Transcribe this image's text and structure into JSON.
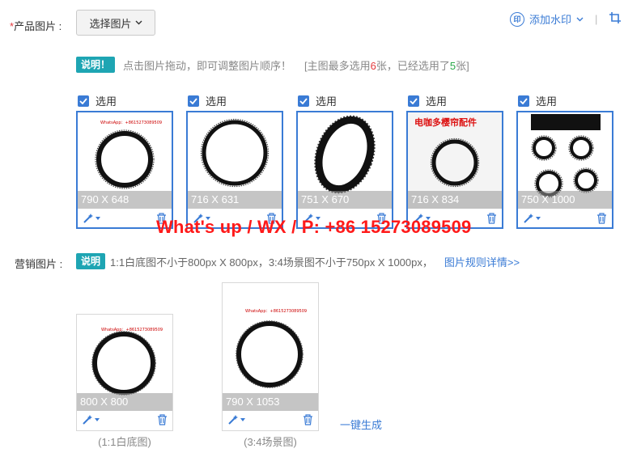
{
  "product": {
    "label_required": "*",
    "label": "产品图片 :",
    "select_button": "选择图片",
    "watermark": {
      "badge": "印",
      "label": "添加水印"
    },
    "note_badge": "说明！",
    "hint_main": "点击图片拖动，即可调整图片顺序！",
    "hint_max_prefix": "[主图最多选用",
    "hint_max_count": "6",
    "hint_max_mid": "张，已经选用了",
    "hint_selected_count": "5",
    "hint_max_suffix": "张]",
    "check_label": "选用",
    "images": [
      {
        "dim": "790 X 648",
        "checked": true,
        "overlay": "WhatsApp：+8615273089509",
        "style": "ring-plain"
      },
      {
        "dim": "716 X 631",
        "checked": true,
        "overlay": "",
        "style": "ring-thin"
      },
      {
        "dim": "751 X 670",
        "checked": true,
        "overlay": "",
        "style": "ring-tilt"
      },
      {
        "dim": "716 X 834",
        "checked": true,
        "overlay": "电咖多樱帘配件",
        "style": "ring-banner"
      },
      {
        "dim": "750 X 1000",
        "checked": true,
        "overlay": "",
        "style": "ring-multi"
      }
    ]
  },
  "contact_text": "What's up / WX / P: +86 15273089509",
  "marketing": {
    "label": "营销图片 :",
    "note_badge": "说明",
    "note_text": "1:1白底图不小于800px X 800px，3:4场景图不小于750px X 1000px，",
    "rules_link": "图片规则详情>>",
    "images": [
      {
        "dim": "800 X 800",
        "caption": "(1:1白底图)",
        "overlay": "WhatsApp：+8615273089509"
      },
      {
        "dim": "790 X 1053",
        "caption": "(3:4场景图)",
        "overlay": "WhatsApp：+8615273089509"
      }
    ],
    "generate_link": "一键生成"
  },
  "colors": {
    "accent": "#3a7bd5",
    "badge": "#1ea5b3",
    "red": "#e4393c",
    "contact": "#ff1a1a"
  }
}
